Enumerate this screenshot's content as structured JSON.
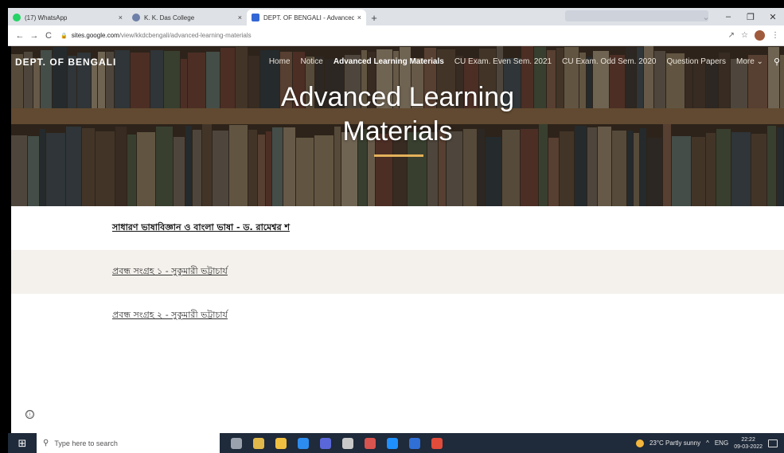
{
  "browser": {
    "tabs": [
      {
        "title": "(17) WhatsApp",
        "favicon_color": "#25D366"
      },
      {
        "title": "K. K. Das College",
        "favicon_color": "#6d7fa8"
      },
      {
        "title": "DEPT. OF BENGALI - Advanced L",
        "favicon_color": "#3367d6"
      }
    ],
    "new_tab_label": "+",
    "close_label": "×",
    "address": {
      "domain": "sites.google.com",
      "path": "/view/kkdcbengali/advanced-learning-materials"
    },
    "window_controls": [
      "⌄",
      "–",
      "❐",
      "✕"
    ],
    "nav_buttons": {
      "back": "←",
      "forward": "→",
      "reload": "C"
    }
  },
  "site": {
    "title": "DEPT. OF BENGALI",
    "nav": [
      {
        "label": "Home"
      },
      {
        "label": "Notice"
      },
      {
        "label": "Advanced Learning Materials",
        "active": true
      },
      {
        "label": "CU Exam. Even Sem. 2021"
      },
      {
        "label": "CU Exam. Odd Sem. 2020"
      },
      {
        "label": "Question Papers"
      },
      {
        "label": "More ⌄"
      }
    ],
    "search_icon": "search-icon"
  },
  "hero": {
    "title_line1": "Advanced Learning",
    "title_line2": "Materials",
    "rule_color": "#e3b15a"
  },
  "materials": [
    {
      "label": "সাধারণ ভাষাবিজ্ঞান ও বাংলা ভাষা - ড. রামেশ্বর শ",
      "bold": true
    },
    {
      "label": "প্রবন্ধ সংগ্রহ ১ - সুকুমারী ভট্টাচার্য",
      "bold": false
    },
    {
      "label": "প্রবন্ধ সংগ্রহ ২ - সুকুমারী ভট্টাচার্য",
      "bold": false
    }
  ],
  "info_icon": "ⓘ",
  "taskbar": {
    "search_placeholder": "Type here to search",
    "weather": "23°C  Partly sunny",
    "language": "ENG",
    "time": "22:22",
    "date": "09-03-2022",
    "app_colors": [
      "#9aa3ad",
      "#e1b94a",
      "#f0c040",
      "#2d8cf0",
      "#5a67d8",
      "#c9c9c9",
      "#d9534f",
      "#1e90ff",
      "#2f6fd6",
      "#e04b3a"
    ]
  }
}
